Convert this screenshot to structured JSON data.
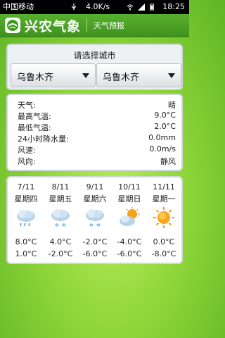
{
  "status_bar": {
    "carrier": "中国移动",
    "network_speed": "4.0K/s",
    "time": "18:25"
  },
  "header": {
    "app_title": "兴农气象",
    "subtitle": "天气预报"
  },
  "city_selector": {
    "title": "请选择城市",
    "left_value": "乌鲁木齐",
    "right_value": "乌鲁木齐"
  },
  "weather_info": [
    {
      "label": "天气:",
      "value": "晴"
    },
    {
      "label": "最高气温:",
      "value": "9.0°C"
    },
    {
      "label": "最低气温:",
      "value": "2.0°C"
    },
    {
      "label": "24小时降水量:",
      "value": "0.0mm"
    },
    {
      "label": "风速:",
      "value": "0.0m/s"
    },
    {
      "label": "风向:",
      "value": "静风"
    }
  ],
  "forecast": [
    {
      "date": "7/11",
      "weekday": "星期四",
      "icon": "cloud-rain-icon",
      "high": "8.0°C",
      "low": "1.0°C"
    },
    {
      "date": "8/11",
      "weekday": "星期五",
      "icon": "cloud-snow-icon",
      "high": "4.0°C",
      "low": "-2.0°C"
    },
    {
      "date": "9/11",
      "weekday": "星期六",
      "icon": "cloud-snow-icon",
      "high": "-2.0°C",
      "low": "-6.0°C"
    },
    {
      "date": "10/11",
      "weekday": "星期日",
      "icon": "partly-cloudy-icon",
      "high": "-4.0°C",
      "low": "-6.0°C"
    },
    {
      "date": "11/11",
      "weekday": "星期一",
      "icon": "sun-icon",
      "high": "0.0°C",
      "low": "-8.0°C"
    }
  ]
}
